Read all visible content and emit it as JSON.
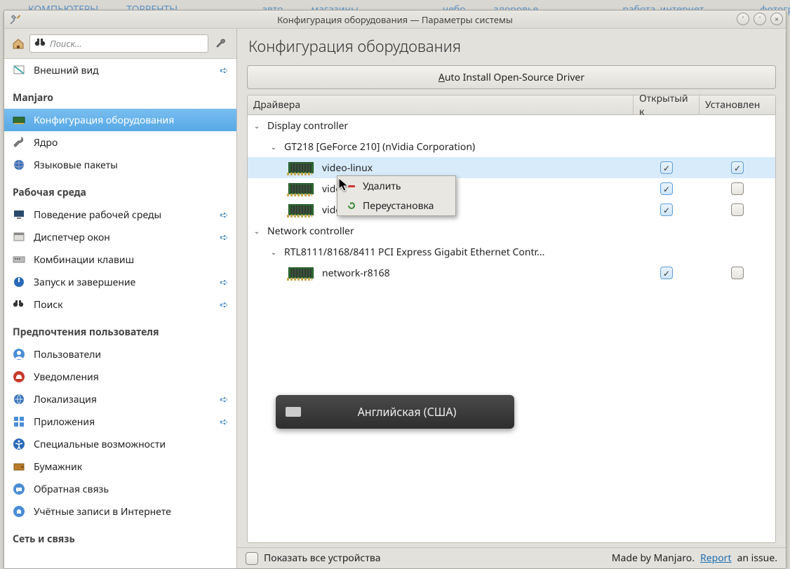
{
  "top_links": [
    "КОМПЬЮТЕРЫ",
    "ТОРРЕНТЫ",
    "",
    "",
    "авто",
    "магазины",
    "",
    "",
    "небо",
    "здоровье",
    "",
    "",
    "работа_интернет",
    "",
    "фотография"
  ],
  "titlebar": {
    "title": "Конфигурация оборудования — Параметры системы"
  },
  "search": {
    "placeholder": "Поиск..."
  },
  "sidebar": {
    "top_item": {
      "label": "Внешний вид",
      "has_link": true
    },
    "groups": [
      {
        "title": "Manjaro",
        "items": [
          {
            "label": "Конфигурация оборудования",
            "icon": "hw",
            "active": true,
            "has_link": false
          },
          {
            "label": "Ядро",
            "icon": "wrench",
            "has_link": false
          },
          {
            "label": "Языковые пакеты",
            "icon": "globe",
            "has_link": false
          }
        ]
      },
      {
        "title": "Рабочая среда",
        "items": [
          {
            "label": "Поведение рабочей среды",
            "icon": "desktop",
            "has_link": true
          },
          {
            "label": "Диспетчер окон",
            "icon": "window",
            "has_link": true
          },
          {
            "label": "Комбинации клавиш",
            "icon": "keys",
            "has_link": false
          },
          {
            "label": "Запуск и завершение",
            "icon": "power",
            "has_link": true
          },
          {
            "label": "Поиск",
            "icon": "search",
            "has_link": true
          }
        ]
      },
      {
        "title": "Предпочтения пользователя",
        "items": [
          {
            "label": "Пользователи",
            "icon": "user",
            "has_link": false
          },
          {
            "label": "Уведомления",
            "icon": "bell",
            "has_link": false
          },
          {
            "label": "Локализация",
            "icon": "locale",
            "has_link": true
          },
          {
            "label": "Приложения",
            "icon": "apps",
            "has_link": true
          },
          {
            "label": "Специальные возможности",
            "icon": "access",
            "has_link": false
          },
          {
            "label": "Бумажник",
            "icon": "wallet",
            "has_link": false
          },
          {
            "label": "Обратная связь",
            "icon": "chat",
            "has_link": false
          },
          {
            "label": "Учётные записи в Интернете",
            "icon": "accounts",
            "has_link": false
          }
        ]
      },
      {
        "title": "Сеть и связь",
        "items": []
      }
    ]
  },
  "content": {
    "title": "Конфигурация оборудования",
    "auto_button_prefix": "A",
    "auto_button_rest": "uto Install Open-Source Driver",
    "columns": {
      "driver": "Драйвера",
      "open": "Открытый к",
      "installed": "Установлен"
    },
    "tree": [
      {
        "label": "Display controller",
        "level": 0,
        "expanded": true
      },
      {
        "label": "GT218 [GeForce 210] (nVidia Corporation)",
        "level": 1,
        "expanded": true
      },
      {
        "label": "video-linux",
        "level": 2,
        "driver": true,
        "open": true,
        "installed": true,
        "selected": true
      },
      {
        "label": "video-modesetting",
        "short": "video",
        "level": 2,
        "driver": true,
        "open": true,
        "installed": false
      },
      {
        "label": "video-vesa",
        "level": 2,
        "driver": true,
        "open": true,
        "installed": false
      },
      {
        "label": "Network controller",
        "level": 0,
        "expanded": true
      },
      {
        "label": "RTL8111/8168/8411 PCI Express Gigabit Ethernet Contr...",
        "level": 1,
        "expanded": true
      },
      {
        "label": "network-r8168",
        "level": 2,
        "driver": true,
        "open": true,
        "installed": false
      }
    ]
  },
  "context_menu": {
    "items": [
      {
        "label": "Удалить",
        "icon": "delete"
      },
      {
        "label": "Переустановка",
        "icon": "refresh"
      }
    ]
  },
  "osd": {
    "text": "Английская (США)"
  },
  "footer": {
    "checkbox": "Показать все устройства",
    "credit_pre": "Made by Manjaro. ",
    "report": "Report",
    "credit_post": " an issue."
  }
}
